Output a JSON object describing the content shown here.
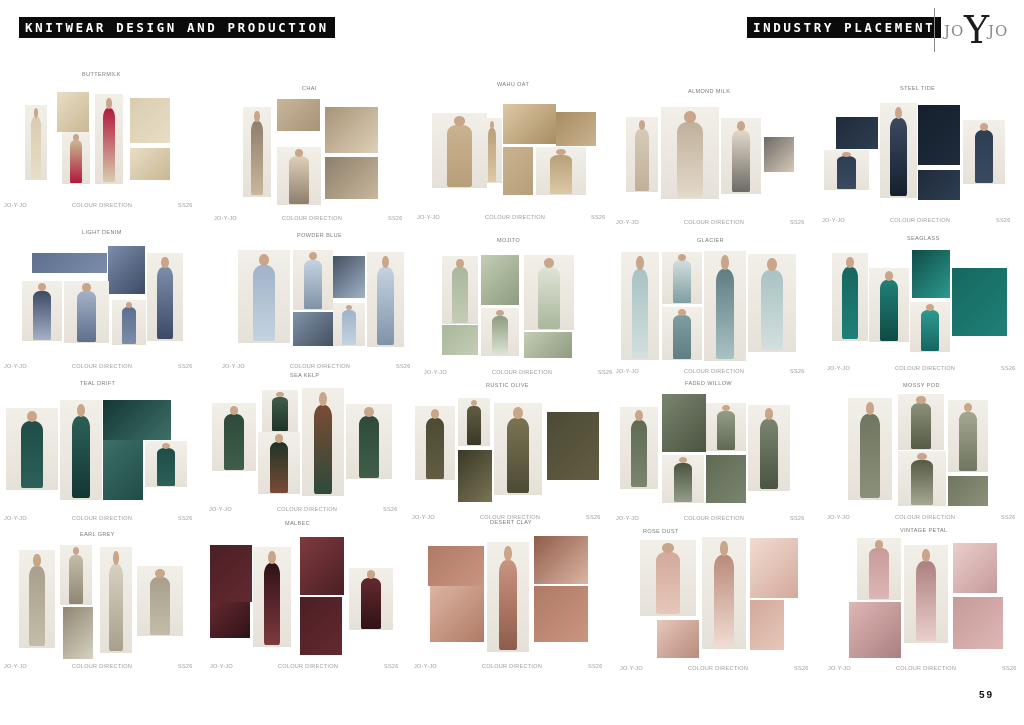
{
  "header": {
    "left_title": "KNITWEAR DESIGN AND PRODUCTION",
    "right_title": "INDUSTRY PLACEMENT",
    "logo_left": "JO",
    "logo_mid": "Y",
    "logo_right": "JO"
  },
  "footer_brand": "JO-Y-JO",
  "footer_section": "COLOUR DIRECTION",
  "footer_season": "SS26",
  "page_number": "59",
  "boards": [
    {
      "name": "BUTTERMILK",
      "x": 0
    },
    {
      "name": "CHAI"
    },
    {
      "name": "WAHU OAT"
    },
    {
      "name": "ALMOND MILK"
    },
    {
      "name": "STEEL TIDE"
    },
    {
      "name": "LIGHT DENIM"
    },
    {
      "name": "POWDER BLUE"
    },
    {
      "name": "MOJITO"
    },
    {
      "name": "GLACIER"
    },
    {
      "name": "SEAGLASS"
    },
    {
      "name": "TEAL DRIFT"
    },
    {
      "name": "SEA KELP"
    },
    {
      "name": "RUSTIC OLIVE"
    },
    {
      "name": "FADED WILLOW"
    },
    {
      "name": "MOSSY POD"
    },
    {
      "name": "EARL GREY"
    },
    {
      "name": "MALBEC"
    },
    {
      "name": "DESERT CLAY"
    },
    {
      "name": "ROSE DUST"
    },
    {
      "name": "VINTAGE PETAL"
    }
  ],
  "palette": {
    "buttermilk": [
      "#d9ccb0",
      "#e8ddc6",
      "#c9b892",
      "#b01a3b"
    ],
    "chai": [
      "#8d7f6d",
      "#c9b79b",
      "#a79377",
      "#ded0b8"
    ],
    "oat": [
      "#c9b28f",
      "#b89f7a",
      "#ddc9a6",
      "#a88d63"
    ],
    "almond": [
      "#d6cab8",
      "#bfb09a",
      "#e3d9ca",
      "#6d6a66"
    ],
    "steel": [
      "#1f2b3a",
      "#2d3e52",
      "#3b4a5e",
      "#14202e"
    ],
    "denim": [
      "#5d6f8e",
      "#7c8dab",
      "#3c4a64",
      "#a5b1c6"
    ],
    "powder": [
      "#9fb3c8",
      "#c5d3e0",
      "#7f93a8",
      "#445060"
    ],
    "mojito": [
      "#a9b79b",
      "#c3cdb5",
      "#8e9c80",
      "#dfe4d6"
    ],
    "glacier": [
      "#a9c2c4",
      "#d2dfde",
      "#7f9ea1",
      "#5f7d82"
    ],
    "seaglass": [
      "#16675f",
      "#1f8078",
      "#0e4b45",
      "#2d9a91"
    ],
    "teal": [
      "#1f4c47",
      "#2c6058",
      "#143633",
      "#3d7067"
    ],
    "kelp": [
      "#2e4a3a",
      "#3e5e49",
      "#1e3327",
      "#7a4b34"
    ],
    "olive": [
      "#4d4a35",
      "#625d42",
      "#3a3826",
      "#7a7454"
    ],
    "willow": [
      "#5f6a54",
      "#7a8570",
      "#4a5440",
      "#939d88"
    ],
    "moss": [
      "#6f7560",
      "#8b9079",
      "#565b47",
      "#a5a890"
    ],
    "earl": [
      "#a8a08c",
      "#c3bca9",
      "#8f8773",
      "#d7d1c1"
    ],
    "malbec": [
      "#4a1f24",
      "#632a30",
      "#2f1216",
      "#7e3a3f"
    ],
    "clay": [
      "#b07a65",
      "#c99581",
      "#8e5c4b",
      "#dcb5a2"
    ],
    "rose": [
      "#d3a99a",
      "#e6c7ba",
      "#b98b7c",
      "#f1dcd2"
    ],
    "petal": [
      "#c79a9a",
      "#ddb7b5",
      "#ad7f80",
      "#e9cfcc"
    ]
  }
}
